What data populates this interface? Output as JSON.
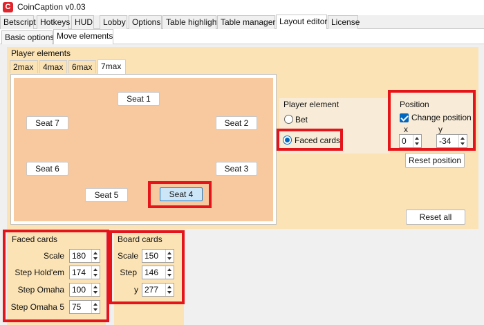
{
  "app": {
    "title": "CoinCaption v0.03",
    "icon": "C"
  },
  "main_tabs": [
    "Betscript",
    "Hotkeys",
    "HUD",
    "Lobby",
    "Options",
    "Table highlight",
    "Table manager",
    "Layout editor",
    "License"
  ],
  "sub_tabs": [
    "Basic options",
    "Move elements"
  ],
  "player_elements": {
    "title": "Player elements",
    "tabs": [
      "2max",
      "4max",
      "6max",
      "7max"
    ],
    "seats": [
      "Seat 1",
      "Seat 2",
      "Seat 3",
      "Seat 4",
      "Seat 5",
      "Seat 6",
      "Seat 7"
    ],
    "selected_seat": "Seat 4"
  },
  "player_element": {
    "title": "Player element",
    "options": [
      "Bet",
      "Faced cards"
    ],
    "selected": "Faced cards"
  },
  "position": {
    "title": "Position",
    "change_label": "Change position",
    "checked": true,
    "x_label": "x",
    "y_label": "y",
    "x_value": "0",
    "y_value": "-34",
    "reset_position": "Reset position"
  },
  "reset_all": "Reset all",
  "faced_cards": {
    "title": "Faced cards",
    "fields": [
      {
        "label": "Scale",
        "value": "180"
      },
      {
        "label": "Step Hold'em",
        "value": "174"
      },
      {
        "label": "Step Omaha",
        "value": "100"
      },
      {
        "label": "Step Omaha 5",
        "value": "75"
      }
    ]
  },
  "board_cards": {
    "title": "Board cards",
    "fields": [
      {
        "label": "Scale",
        "value": "150"
      },
      {
        "label": "Step",
        "value": "146"
      },
      {
        "label": "y",
        "value": "277"
      }
    ]
  },
  "colors": {
    "panel": "#fbe3b5",
    "felt": "#f8c99f",
    "highlight": "#e4141a",
    "accent": "#0067c0"
  }
}
